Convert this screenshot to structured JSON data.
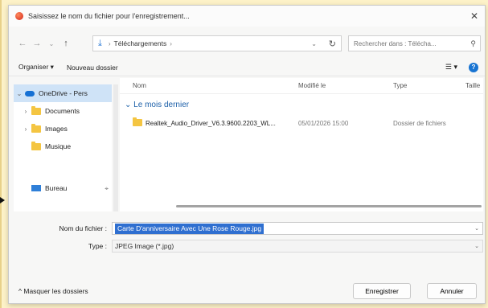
{
  "window": {
    "title": "Saisissez le nom du fichier pour l'enregistrement..."
  },
  "address": {
    "folder": "Téléchargements",
    "search_placeholder": "Rechercher dans : Télécha..."
  },
  "toolbar": {
    "organize": "Organiser ▾",
    "new_folder": "Nouveau dossier"
  },
  "sidebar": {
    "items": [
      {
        "label": "OneDrive - Pers"
      },
      {
        "label": "Documents"
      },
      {
        "label": "Images"
      },
      {
        "label": "Musique"
      },
      {
        "label": "Bureau"
      }
    ]
  },
  "columns": {
    "name": "Nom",
    "modified": "Modifié le",
    "type": "Type",
    "size": "Taille"
  },
  "group": {
    "label": "Le mois dernier"
  },
  "files": [
    {
      "name": "Realtek_Audio_Driver_V6.3.9600.2203_WL...",
      "modified": "05/01/2026 15:00",
      "type": "Dossier de fichiers"
    }
  ],
  "form": {
    "filename_label": "Nom du fichier :",
    "filename_value": "Carte D'anniversaire Avec Une Rose Rouge.jpg",
    "type_label": "Type :",
    "type_value": "JPEG Image (*.jpg)"
  },
  "footer": {
    "hide_folders": "Masquer les dossiers",
    "save": "Enregistrer",
    "cancel": "Annuler"
  }
}
